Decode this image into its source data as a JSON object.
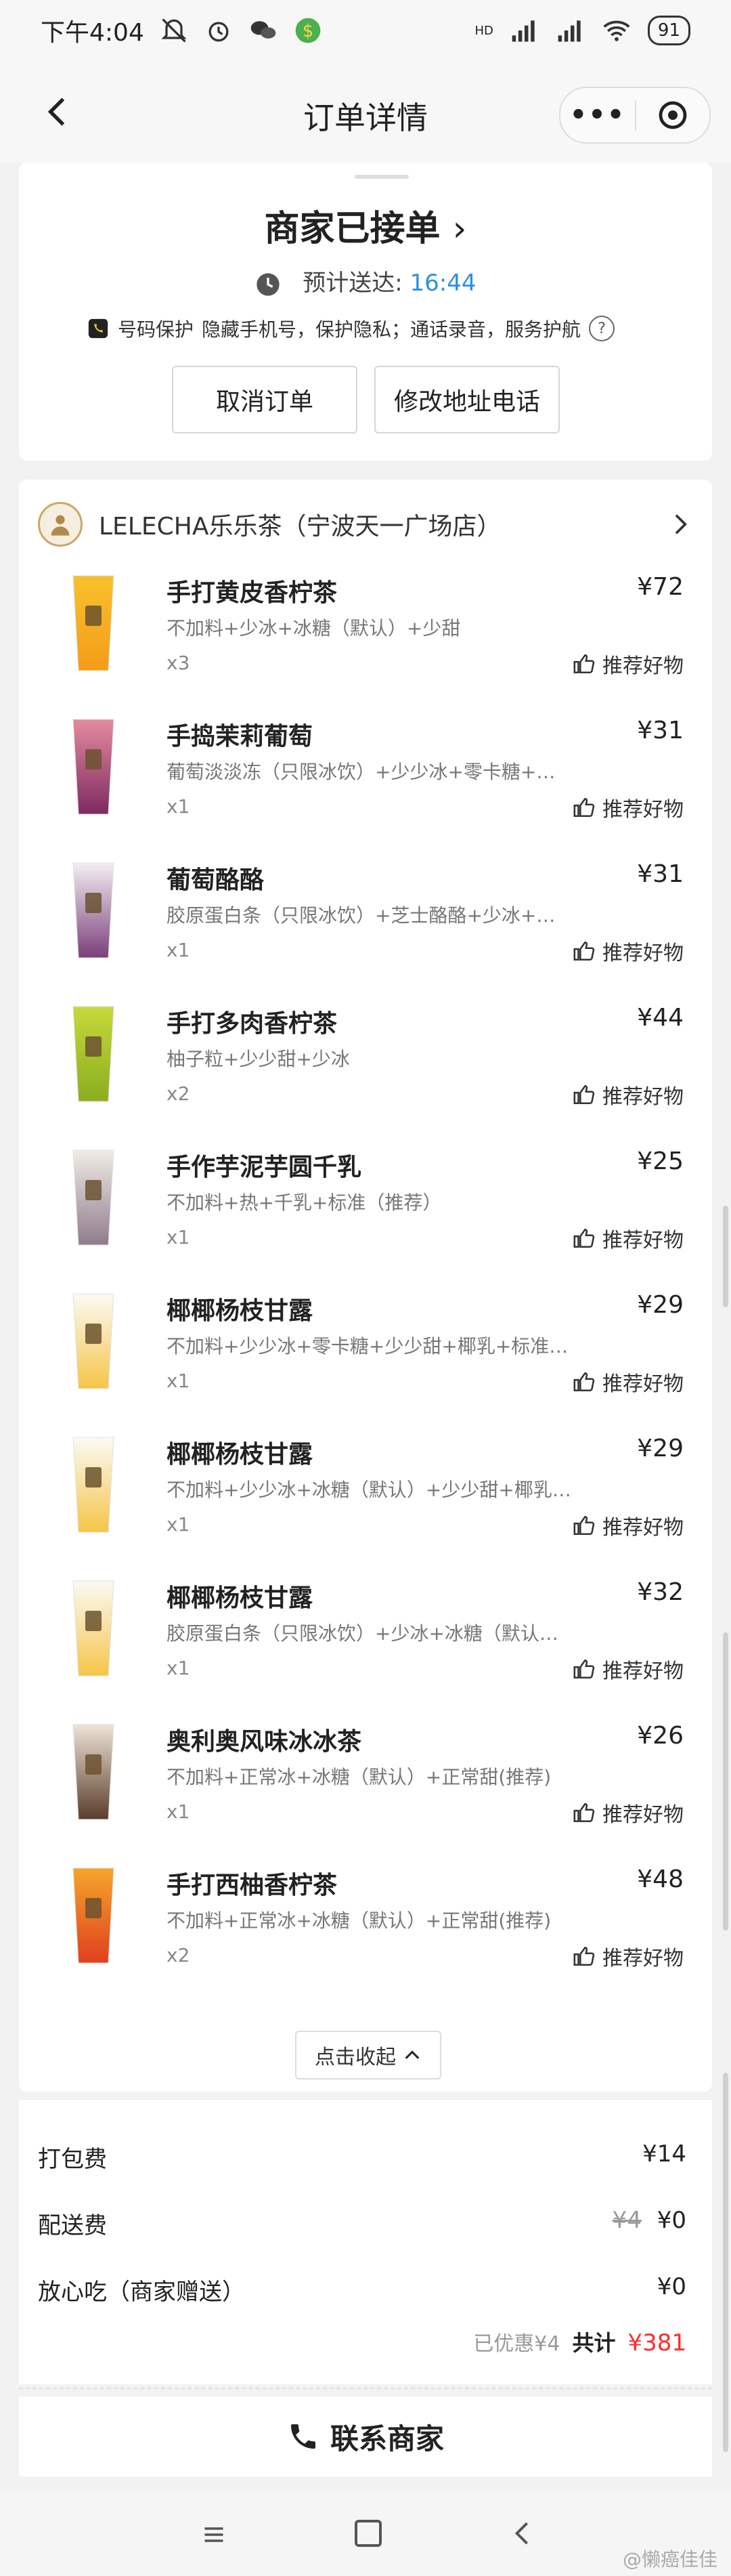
{
  "status_bar": {
    "time": "下午4:04",
    "network": "HD",
    "battery": "91"
  },
  "nav": {
    "title": "订单详情",
    "more": "•••"
  },
  "order_status": {
    "title": "商家已接单",
    "eta_label": "预计送达:",
    "eta_time": "16:44",
    "privacy_label": "号码保护",
    "privacy_text": "隐藏手机号，保护隐私；通话录音，服务护航",
    "help": "?",
    "cancel_btn": "取消订单",
    "modify_btn": "修改地址电话"
  },
  "shop": {
    "name": "LELECHA乐乐茶（宁波天一广场店）"
  },
  "recommend_label": "推荐好物",
  "items": [
    {
      "name": "手打黄皮香柠茶",
      "price": "¥72",
      "spec": "不加料+少冰+冰糖（默认）+少甜",
      "qty": "x3",
      "colors": [
        "#f7c12c",
        "#f49c1a"
      ]
    },
    {
      "name": "手捣茉莉葡萄",
      "price": "¥31",
      "spec": "葡萄淡淡冻（只限冰饮）+少少冰+零卡糖+…",
      "qty": "x1",
      "colors": [
        "#e48aa0",
        "#7e2a60"
      ]
    },
    {
      "name": "葡萄酪酪",
      "price": "¥31",
      "spec": "胶原蛋白条（只限冰饮）+芝士酪酪+少冰+…",
      "qty": "x1",
      "colors": [
        "#f4eef3",
        "#7a3f7a"
      ]
    },
    {
      "name": "手打多肉香柠茶",
      "price": "¥44",
      "spec": "柚子粒+少少甜+少冰",
      "qty": "x2",
      "colors": [
        "#c6d93a",
        "#8aae1f"
      ]
    },
    {
      "name": "手作芋泥芋圆千乳",
      "price": "¥25",
      "spec": "不加料+热+千乳+标准（推荐）",
      "qty": "x1",
      "colors": [
        "#f1ece6",
        "#8e7c8c"
      ]
    },
    {
      "name": "椰椰杨枝甘露",
      "price": "¥29",
      "spec": "不加料+少少冰+零卡糖+少少甜+椰乳+标准…",
      "qty": "x1",
      "colors": [
        "#fbfaf5",
        "#f5c547"
      ]
    },
    {
      "name": "椰椰杨枝甘露",
      "price": "¥29",
      "spec": "不加料+少少冰+冰糖（默认）+少少甜+椰乳…",
      "qty": "x1",
      "colors": [
        "#fbfaf5",
        "#f5c547"
      ]
    },
    {
      "name": "椰椰杨枝甘露",
      "price": "¥32",
      "spec": "胶原蛋白条（只限冰饮）+少冰+冰糖（默认…",
      "qty": "x1",
      "colors": [
        "#fbfaf5",
        "#f5c547"
      ]
    },
    {
      "name": "奥利奥风味冰冰茶",
      "price": "¥26",
      "spec": "不加料+正常冰+冰糖（默认）+正常甜(推荐)",
      "qty": "x1",
      "colors": [
        "#eee4d6",
        "#5a3c2b"
      ]
    },
    {
      "name": "手打西柚香柠茶",
      "price": "¥48",
      "spec": "不加料+正常冰+冰糖（默认）+正常甜(推荐)",
      "qty": "x2",
      "colors": [
        "#f6a52a",
        "#e0401f"
      ]
    }
  ],
  "collapse_label": "点击收起",
  "fees": {
    "packing_label": "打包费",
    "packing_value": "¥14",
    "delivery_label": "配送费",
    "delivery_original": "¥4",
    "delivery_value": "¥0",
    "gift_label": "放心吃（商家赠送）",
    "gift_value": "¥0",
    "discount_text": "已优惠¥4",
    "total_label": "共计",
    "total_value": "¥381"
  },
  "contact_label": "联系商家",
  "watermark": "@懒癌佳佳",
  "colors": {
    "accent_blue": "#2f8fe0",
    "total_red": "#ff2d2d"
  }
}
